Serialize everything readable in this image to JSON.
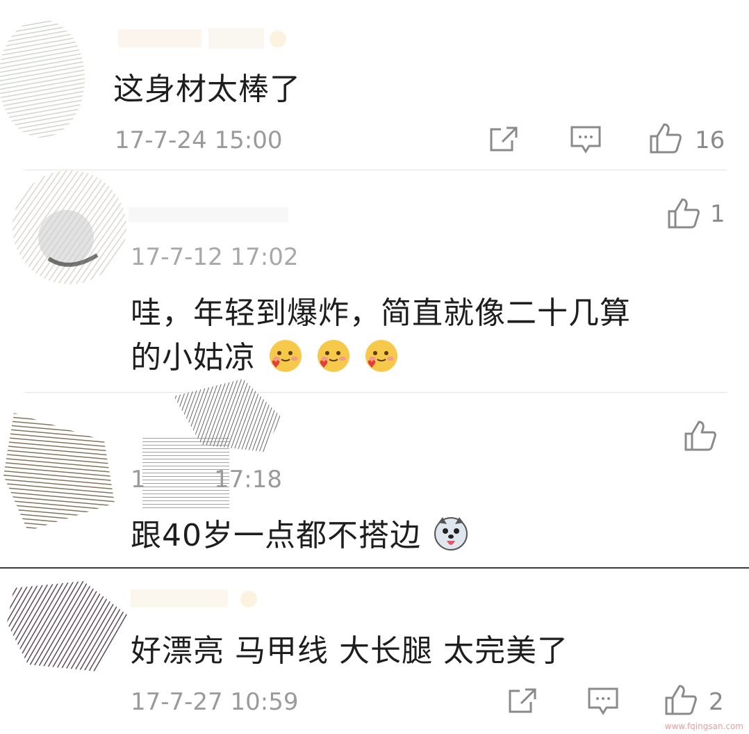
{
  "comments": [
    {
      "text": "这身材太棒了",
      "time": "17-7-24 15:00",
      "likes": "16"
    },
    {
      "text_line1": "哇，年轻到爆炸，简直就像二十几算",
      "text_line2": "的小姑凉",
      "time": "17-7-12 17:02",
      "likes": "1"
    },
    {
      "text": "跟40岁一点都不搭边",
      "time": "17:18",
      "time_prefix": "1"
    },
    {
      "text": "好漂亮 马甲线 大长腿 太完美了",
      "time": "17-7-27 10:59",
      "likes": "2"
    }
  ],
  "watermark": "www.fqingsan.com",
  "icons": {
    "share": "share-icon",
    "comment": "comment-icon",
    "like": "thumbs-up-icon",
    "emoji_blush": "blush-heart-emoji",
    "emoji_dog": "husky-dog-emoji"
  }
}
